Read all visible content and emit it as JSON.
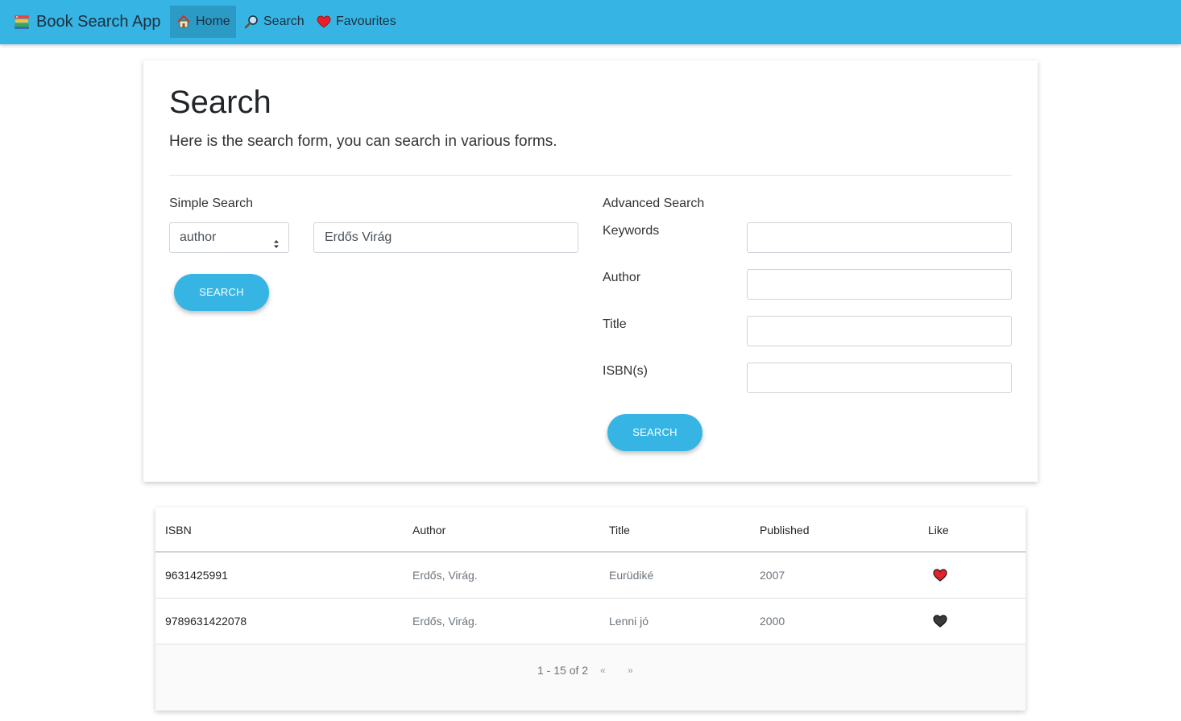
{
  "app": {
    "brand": "Book Search App",
    "nav": [
      {
        "label": "Home",
        "icon": "home-icon",
        "active": true
      },
      {
        "label": "Search",
        "icon": "search-icon",
        "active": false
      },
      {
        "label": "Favourites",
        "icon": "heart-icon",
        "active": false
      }
    ]
  },
  "search_page": {
    "title": "Search",
    "lead": "Here is the search form, you can search in various forms.",
    "simple": {
      "label": "Simple Search",
      "field_selected": "author",
      "query_value": "Erdős Virág",
      "button": "SEARCH"
    },
    "advanced": {
      "label": "Advanced Search",
      "fields": [
        {
          "label": "Keywords",
          "value": ""
        },
        {
          "label": "Author",
          "value": ""
        },
        {
          "label": "Title",
          "value": ""
        },
        {
          "label": "ISBN(s)",
          "value": ""
        }
      ],
      "button": "SEARCH"
    }
  },
  "results": {
    "columns": [
      "ISBN",
      "Author",
      "Title",
      "Published",
      "Like"
    ],
    "rows": [
      {
        "isbn": "9631425991",
        "author": "Erdős, Virág.",
        "title": "Eurüdiké",
        "published": "2007",
        "liked": true
      },
      {
        "isbn": "9789631422078",
        "author": "Erdős, Virág.",
        "title": "Lenni jó",
        "published": "2000",
        "liked": false
      }
    ],
    "pagination": {
      "range": "1 - 15 of 2",
      "prev": "«",
      "next": "»"
    }
  },
  "colors": {
    "accent": "#36b5e5",
    "nav_active": "#2b9bc6",
    "heart_liked": "#e8202a",
    "heart_unliked": "#333333"
  }
}
